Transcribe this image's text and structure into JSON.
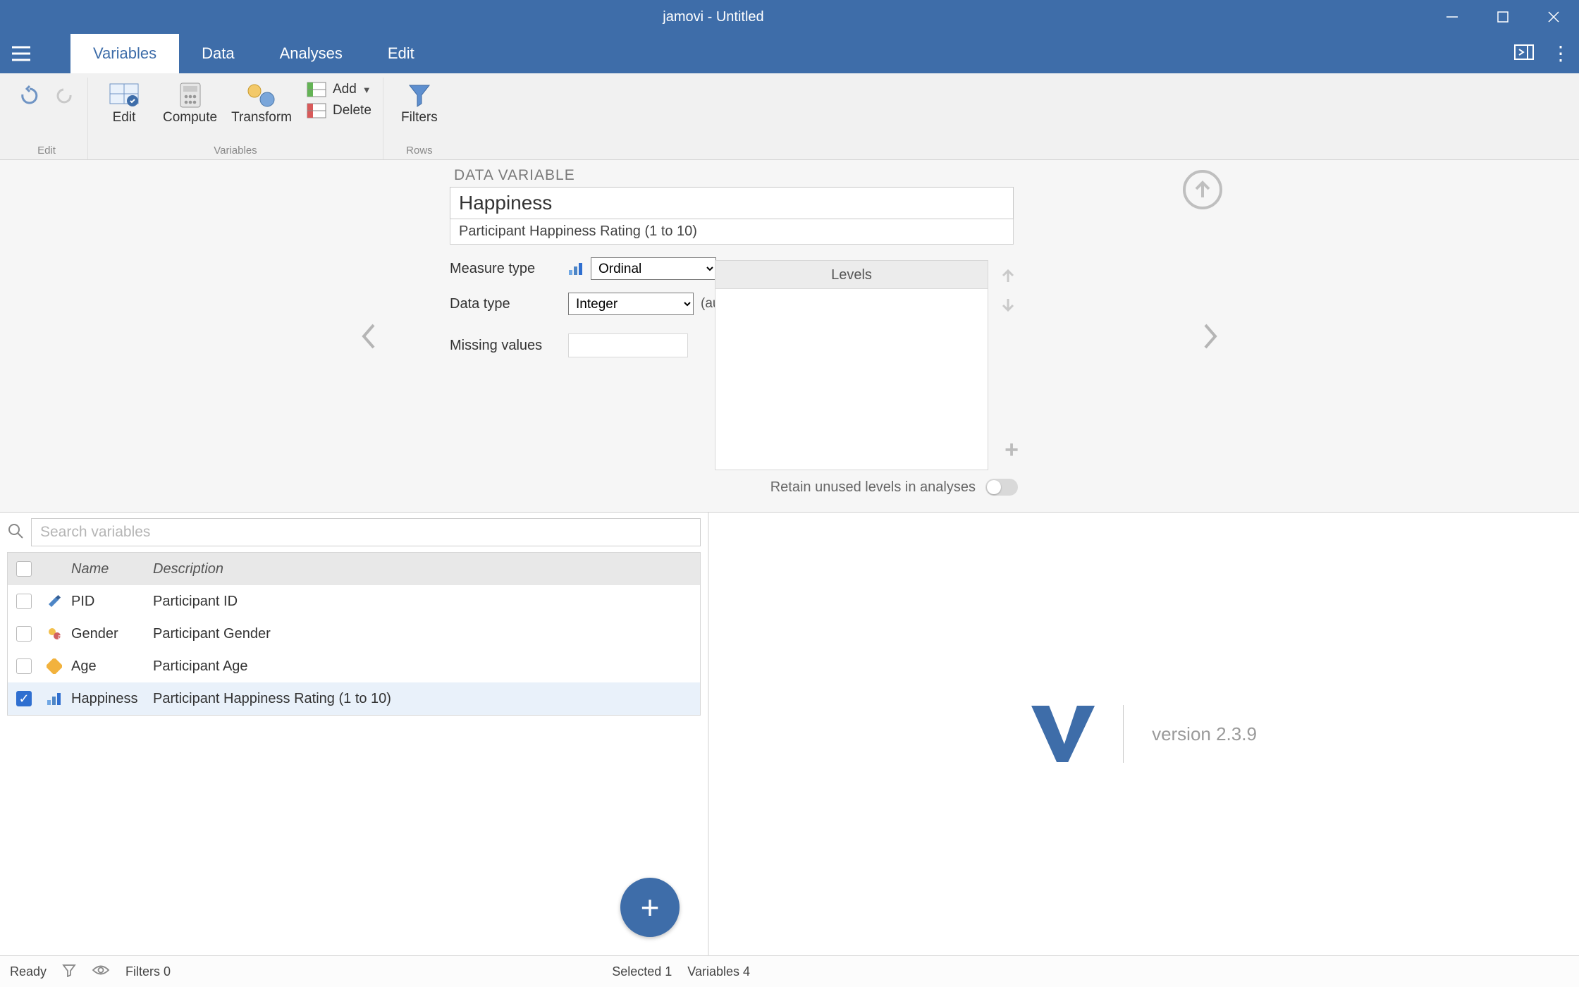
{
  "window": {
    "title": "jamovi - Untitled"
  },
  "tabs": {
    "variables": "Variables",
    "data": "Data",
    "analyses": "Analyses",
    "edit": "Edit"
  },
  "ribbon": {
    "undo_group_edit": "Edit",
    "edit": "Edit",
    "compute": "Compute",
    "transform": "Transform",
    "add": "Add",
    "delete": "Delete",
    "variables_caption": "Variables",
    "filters": "Filters",
    "rows_caption": "Rows"
  },
  "editor": {
    "caption": "DATA VARIABLE",
    "name": "Happiness",
    "description": "Participant Happiness Rating (1 to 10)",
    "measure_label": "Measure type",
    "measure_value": "Ordinal",
    "datatype_label": "Data type",
    "datatype_value": "Integer",
    "datatype_auto": "(auto)",
    "missing_label": "Missing values",
    "levels_label": "Levels",
    "retain_label": "Retain unused levels in analyses"
  },
  "search": {
    "placeholder": "Search variables"
  },
  "columns": {
    "name": "Name",
    "description": "Description"
  },
  "variables": [
    {
      "selected": false,
      "type": "id",
      "name": "PID",
      "description": "Participant ID"
    },
    {
      "selected": false,
      "type": "nominal",
      "name": "Gender",
      "description": "Participant Gender"
    },
    {
      "selected": false,
      "type": "continuous",
      "name": "Age",
      "description": "Participant Age"
    },
    {
      "selected": true,
      "type": "ordinal",
      "name": "Happiness",
      "description": "Participant Happiness Rating (1 to 10)"
    }
  ],
  "results": {
    "version_label": "version 2.3.9"
  },
  "status": {
    "ready": "Ready",
    "filters": "Filters 0",
    "selected": "Selected 1",
    "variables": "Variables 4"
  }
}
